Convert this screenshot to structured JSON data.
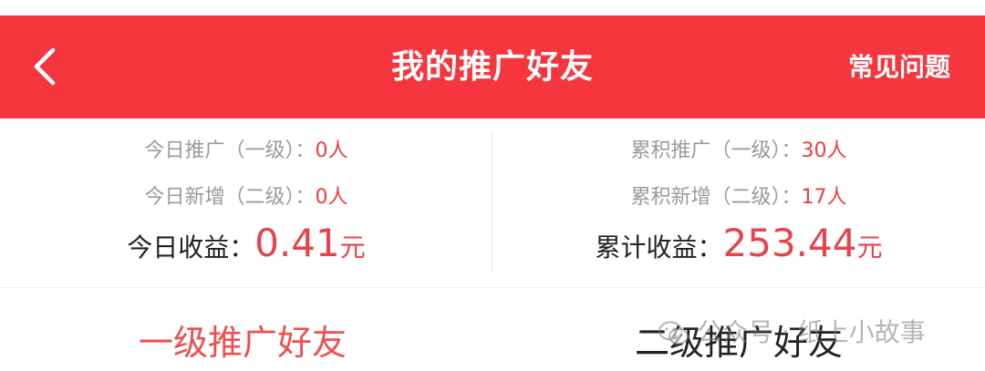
{
  "header": {
    "title": "我的推广好友",
    "faq_label": "常见问题",
    "bg_color": "#f6363f",
    "back_icon": "chevron-left-icon"
  },
  "today": {
    "promote_label": "今日推广（一级）：",
    "promote_value": "0人",
    "new_label": "今日新增（二级）：",
    "new_value": "0人",
    "income_label": "今日收益：",
    "income_value": "0.41",
    "income_unit": "元"
  },
  "total": {
    "promote_label": "累积推广（一级）：",
    "promote_value": "30人",
    "new_label": "累积新增（二级）：",
    "new_value": "17人",
    "income_label": "累计收益：",
    "income_value": "253.44",
    "income_unit": "元"
  },
  "tabs": [
    {
      "label": "一级推广好友",
      "active": true
    },
    {
      "label": "二级推广好友",
      "active": false
    }
  ],
  "watermark": {
    "text": "公众号 · 纸上小故事",
    "icon": "wechat-icon"
  },
  "colors": {
    "accent": "#ef3e3e",
    "active_tab": "#ef4f4f"
  }
}
